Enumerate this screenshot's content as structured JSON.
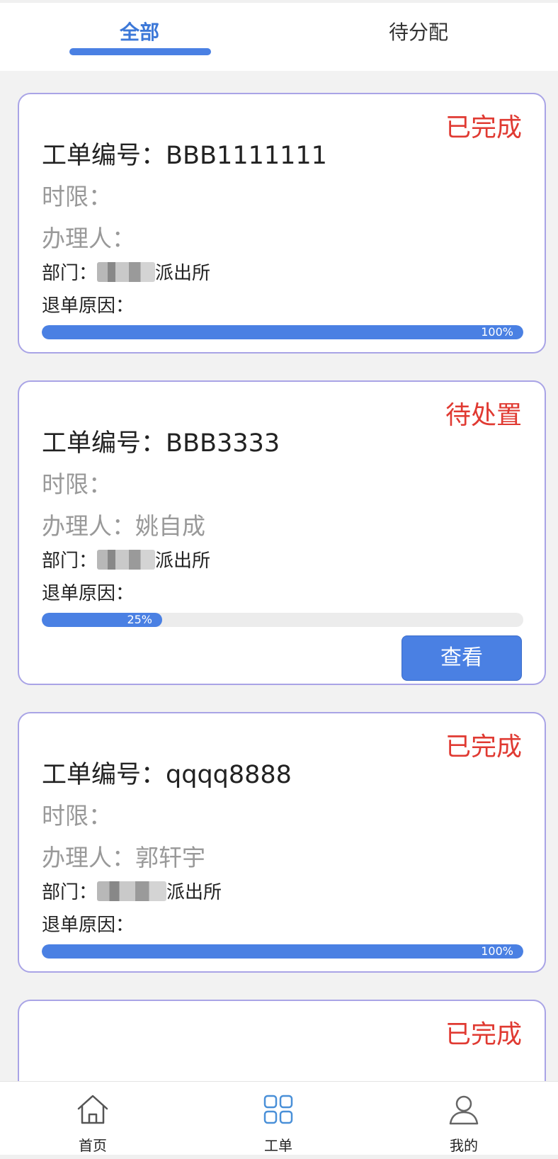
{
  "tabs": [
    {
      "label": "全部",
      "active": true
    },
    {
      "label": "待分配",
      "active": false
    }
  ],
  "labels": {
    "order_no": "工单编号：",
    "time_limit": "时限：",
    "handler": "办理人：",
    "dept": "部门：",
    "return_reason": "退单原因："
  },
  "cards": [
    {
      "status": "已完成",
      "order_no": "BBB1111111",
      "time_limit": "",
      "handler": "",
      "dept_suffix": "派出所",
      "return_reason": "",
      "progress": 100,
      "progress_label": "100%"
    },
    {
      "status": "待处置",
      "order_no": "BBB3333",
      "time_limit": "",
      "handler": "姚自成",
      "dept_suffix": "派出所",
      "return_reason": "",
      "progress": 25,
      "progress_label": "25%",
      "action_label": "查看"
    },
    {
      "status": "已完成",
      "order_no": "qqqq8888",
      "time_limit": "",
      "handler": "郭轩宇",
      "dept_suffix": "派出所",
      "return_reason": "",
      "progress": 100,
      "progress_label": "100%"
    },
    {
      "status": "已完成"
    }
  ],
  "bottom_nav": [
    {
      "label": "首页",
      "icon": "home-icon",
      "active": false
    },
    {
      "label": "工单",
      "icon": "grid-icon",
      "active": true
    },
    {
      "label": "我的",
      "icon": "user-icon",
      "active": false
    }
  ],
  "colors": {
    "accent": "#4a80e3",
    "status_red": "#e03a32",
    "card_border": "#a9a4e6"
  }
}
